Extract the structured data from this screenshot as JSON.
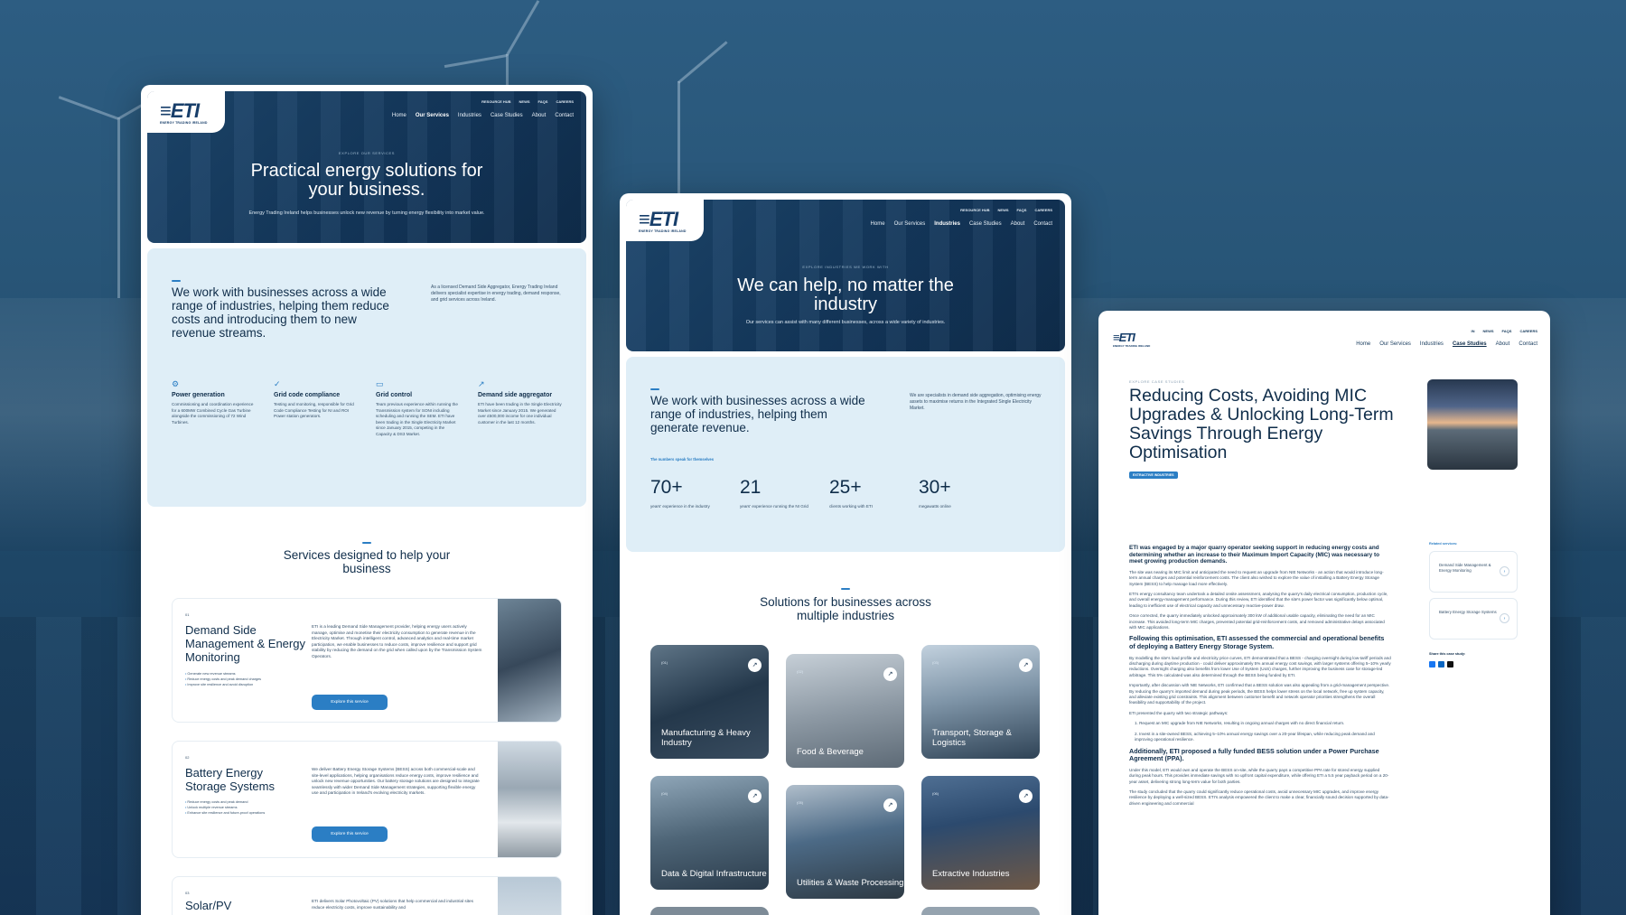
{
  "logo": {
    "mark": "≡ETI",
    "subtitle": "ENERGY TRADING IRELAND"
  },
  "topnav": [
    "RESOURCE HUB",
    "NEWS",
    "FAQS",
    "CAREERS"
  ],
  "mainnav": [
    "Home",
    "Our Services",
    "Industries",
    "Case Studies",
    "About",
    "Contact"
  ],
  "services_page": {
    "eyebrow": "EXPLORE OUR SERVICES",
    "hero_title": "Practical energy solutions for your business.",
    "hero_sub": "Energy Trading Ireland helps businesses unlock new revenue by turning energy flexibility into market value.",
    "intro_title": "We work with businesses across a wide range of industries, helping them reduce costs and introducing them to new revenue streams.",
    "intro_text": "As a licensed Demand Side Aggregator, Energy Trading Ireland delivers specialist expertise in energy trading, demand response, and grid services across Ireland.",
    "features": [
      {
        "icon": "⚙",
        "title": "Power generation",
        "text": "Commissioning and coordination experience for a 600MW Combined Cycle Gas Turbine alongside the commissioning of 72 Wind Turbines."
      },
      {
        "icon": "✓",
        "title": "Grid code compliance",
        "text": "Testing and monitoring, responsible for Grid Code Compliance Testing for NI and ROI Power station generators."
      },
      {
        "icon": "▭",
        "title": "Grid control",
        "text": "Team previous experience within running the Transmission system for SONI including scheduling and running the SEM. ETI have been trading in the Single Electricity Market since January 2015, competing in the Capacity & DS3 Market."
      },
      {
        "icon": "↗",
        "title": "Demand side aggregator",
        "text": "ETI have been trading in the Single Electricity Market since January 2015. We generated over £500,000 income for one individual customer in the last 12 months."
      }
    ],
    "services_title": "Services designed to help your business",
    "cards": [
      {
        "num": "01",
        "title": "Demand Side Management & Energy Monitoring",
        "text": "ETI is a leading Demand Side Management provider, helping energy users actively manage, optimise and monetise their electricity consumption to generate revenue in the Electricity Market. Through intelligent control, advanced analytics and real-time market participation, we enable businesses to reduce costs, improve resilience and support grid stability by reducing the demand on the grid when called upon by the Transmission System Operators.",
        "bullets": [
          "Generate new revenue streams",
          "Reduce energy costs and peak demand charges",
          "Improve site resilience and avoid disruption"
        ],
        "button": "Explore this service"
      },
      {
        "num": "02",
        "title": "Battery Energy Storage Systems",
        "text": "We deliver Battery Energy Storage Systems (BESS) across both commercial-scale and site-level applications, helping organisations reduce energy costs, improve resilience and unlock new revenue opportunities. Our battery storage solutions are designed to integrate seamlessly with wider Demand Side Management strategies, supporting flexible energy use and participation in Ireland's evolving electricity markets.",
        "bullets": [
          "Reduce energy costs and peak demand",
          "Unlock multiple revenue streams",
          "Enhance site resilience and future-proof operations"
        ],
        "button": "Explore this service"
      },
      {
        "num": "03",
        "title": "Solar/PV",
        "text": "ETI delivers Solar Photovoltaic (PV) solutions that help commercial and industrial sites reduce electricity costs, improve sustainability and",
        "bullets": [],
        "button": ""
      }
    ]
  },
  "industries_page": {
    "eyebrow": "EXPLORE INDUSTRIES WE WORK WITH",
    "hero_title": "We can help, no matter the industry",
    "hero_sub": "Our services can assist with many different businesses, across a wide variety of industries.",
    "intro_title": "We work with businesses across a wide range of industries, helping them generate revenue.",
    "intro_text": "We are specialists in demand side aggregation, optimising energy assets to maximise returns in the Integrated Single Electricity Market.",
    "numbers_label": "The numbers speak for themselves",
    "stats": [
      {
        "value": "70+",
        "label": "years' experience in the industry"
      },
      {
        "value": "21",
        "label": "years' experience running the NI Grid"
      },
      {
        "value": "25+",
        "label": "clients working with ETI"
      },
      {
        "value": "30+",
        "label": "megawatts online"
      }
    ],
    "solutions_title": "Solutions for businesses across multiple industries",
    "tiles": [
      {
        "num": "(01)",
        "label": "Manufacturing & Heavy Industry"
      },
      {
        "num": "(02)",
        "label": "Food & Beverage"
      },
      {
        "num": "(03)",
        "label": "Transport, Storage & Logistics"
      },
      {
        "num": "(04)",
        "label": "Data & Digital Infrastructure"
      },
      {
        "num": "(05)",
        "label": "Utilities & Waste Processing"
      },
      {
        "num": "(06)",
        "label": "Extractive Industries"
      }
    ]
  },
  "case_page": {
    "topnav": [
      "IN",
      "NEWS",
      "FAQS",
      "CAREERS"
    ],
    "eyebrow": "EXPLORE CASE STUDIES",
    "title": "Reducing Costs, Avoiding MIC Upgrades & Unlocking Long-Term Savings Through Energy Optimisation",
    "tag": "EXTRACTIVE INDUSTRIES",
    "lead": "ETI was engaged by a major quarry operator seeking support in reducing energy costs and determining whether an increase to their Maximum Import Capacity (MIC) was necessary to meet growing production demands.",
    "p1": "The site was nearing its MIC limit and anticipated the need to request an upgrade from NIE Networks - an action that would introduce long-term annual charges and potential reinforcement costs. The client also wished to explore the value of installing a Battery Energy Storage System (BESS) to help manage load more effectively.",
    "p2": "ETI's energy consultancy team undertook a detailed onsite assessment, analysing the quarry's daily electrical consumption, production cycle, and overall energy-management performance. During this review, ETI identified that the site's power factor was significantly below optimal, leading to inefficient use of electrical capacity and unnecessary reactive-power draw.",
    "p3": "Once corrected, the quarry immediately unlocked approximately 300 kW of additional usable capacity, eliminating the need for an MIC increase. This avoided long-term MIC charges, prevented potential grid-reinforcement costs, and removed administrative delays associated with MIC applications.",
    "h2": "Following this optimisation, ETI assessed the commercial and operational benefits of deploying a Battery Energy Storage System.",
    "p4": "By modelling the site's load profile and electricity price curves, ETI demonstrated that a BESS - charging overnight during low-tariff periods and discharging during daytime production - could deliver approximately 5% annual energy cost savings, with larger systems offering 5–10% yearly reductions. Overnight charging also benefits from lower Use of System (UoS) charges, further improving the business case for storage-led arbitrage. This 5% calculated was also determined through the BESS being funded by ETI.",
    "p5": "Importantly, after discussion with NIE Networks, ETI confirmed that a BESS solution was also appealing from a grid-management perspective. By reducing the quarry's imported demand during peak periods, the BESS helps lower stress on the local network, free up system capacity, and alleviate existing grid constraints. This alignment between customer benefit and network operator priorities strengthens the overall feasibility and supportability of the project.",
    "p6": "ETI presented the quarry with two strategic pathways:",
    "li1": "1.  Request an MIC upgrade from NIE Networks, resulting in ongoing annual charges with no direct financial return.",
    "li2": "2.  Invest in a site-owned BESS, achieving 5–10% annual energy savings over a 20-year lifespan, while reducing peak demand and improving operational resilience.",
    "h3": "Additionally, ETI proposed a fully funded BESS solution under a Power Purchase Agreement (PPA).",
    "p7": "Under this model, ETI would own and operate the BESS on-site, while the quarry pays a competitive PPA rate for stored energy supplied during peak hours. This provides immediate savings with no upfront capital expenditure, while offering ETI a 5.5 year payback period on a 20-year asset, delivering strong long-term value for both parties.",
    "p8": "The study concluded that the quarry could significantly reduce operational costs, avoid unnecessary MIC upgrades, and improve energy resilience by deploying a well-sized BESS. ETI's analysis empowered the client to make a clear, financially sound decision supported by data-driven engineering and commercial",
    "related_label": "Related services:",
    "related": [
      "Demand Side Management & Energy Monitoring",
      "Battery Energy Storage Systems"
    ],
    "share_label": "Share this case study:"
  },
  "colors": {
    "brand": "#173e6a",
    "accent": "#2b7ec4",
    "panel": "#dfeef7"
  }
}
